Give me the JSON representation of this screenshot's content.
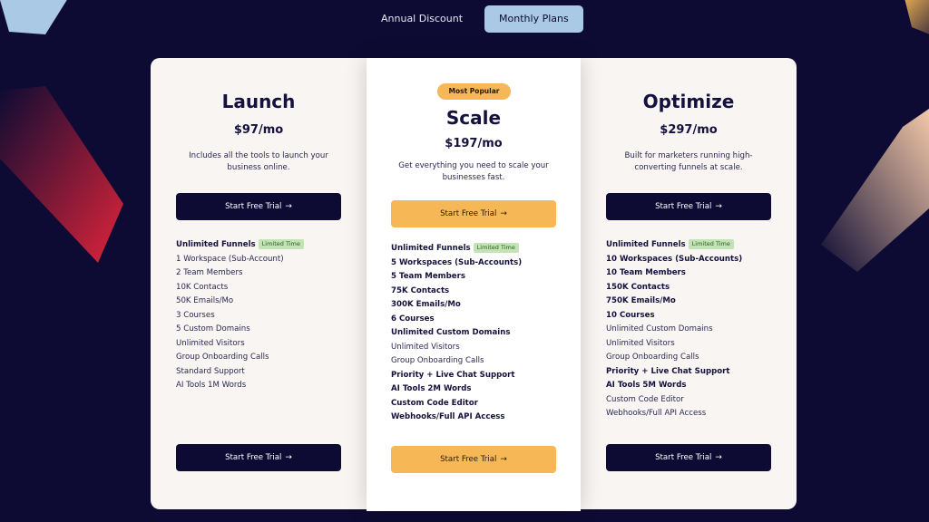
{
  "toggle": {
    "annual": "Annual Discount",
    "monthly": "Monthly Plans"
  },
  "colors": {
    "background": "#0d0b33",
    "accent": "#f6b857",
    "button_dark": "#0d0b33",
    "toggle_active": "#a9c9e4",
    "tag": "#c3e3b6"
  },
  "launch": {
    "name": "Launch",
    "price": "$97/mo",
    "desc1": "Includes all the tools to launch your",
    "desc2": "business online.",
    "cta": "Start Free Trial",
    "features": [
      {
        "text": "Unlimited Funnels",
        "tag": "Limited Time"
      },
      {
        "text": "1 Workspace (Sub-Account)"
      },
      {
        "text": "2 Team Members"
      },
      {
        "text": "10K Contacts"
      },
      {
        "text": "50K Emails/Mo"
      },
      {
        "text": "3 Courses"
      },
      {
        "text": "5 Custom Domains"
      },
      {
        "text": "Unlimited Visitors"
      },
      {
        "text": "Group Onboarding Calls"
      },
      {
        "text": "Standard Support"
      },
      {
        "text": "AI Tools 1M Words"
      }
    ]
  },
  "scale": {
    "badge": "Most Popular",
    "name": "Scale",
    "price": "$197/mo",
    "desc1": "Get everything you need to scale your",
    "desc2": "businesses fast.",
    "cta": "Start Free Trial",
    "features": [
      {
        "text": "Unlimited Funnels",
        "tag": "Limited Time"
      },
      {
        "text": "5 Workspaces (Sub-Accounts)"
      },
      {
        "text": "5 Team Members"
      },
      {
        "text": "75K Contacts"
      },
      {
        "text": "300K Emails/Mo"
      },
      {
        "text": "6 Courses"
      },
      {
        "text": "Unlimited Custom Domains"
      },
      {
        "text": "Unlimited Visitors"
      },
      {
        "text": "Group Onboarding Calls"
      },
      {
        "text": "Priority + Live Chat Support"
      },
      {
        "text": "AI Tools 2M Words"
      },
      {
        "text": "Custom Code Editor"
      },
      {
        "text": "Webhooks/Full API Access"
      }
    ]
  },
  "optimize": {
    "name": "Optimize",
    "price": "$297/mo",
    "desc1": "Built for marketers running high-",
    "desc2": "converting funnels at scale.",
    "cta": "Start Free Trial",
    "features": [
      {
        "text": "Unlimited Funnels",
        "tag": "Limited Time"
      },
      {
        "text": "10 Workspaces (Sub-Accounts)"
      },
      {
        "text": "10 Team Members"
      },
      {
        "text": "150K Contacts"
      },
      {
        "text": "750K Emails/Mo"
      },
      {
        "text": "10 Courses"
      },
      {
        "text": "Unlimited Custom Domains"
      },
      {
        "text": "Unlimited Visitors"
      },
      {
        "text": "Group Onboarding Calls"
      },
      {
        "text": "Priority + Live Chat Support"
      },
      {
        "text": "AI Tools 5M Words"
      },
      {
        "text": "Custom Code Editor"
      },
      {
        "text": "Webhooks/Full API Access"
      }
    ]
  }
}
